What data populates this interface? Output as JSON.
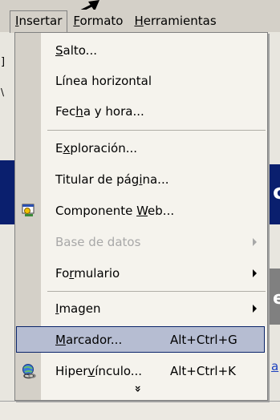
{
  "menubar": {
    "items": [
      {
        "pre": "",
        "u": "I",
        "post": "nsertar"
      },
      {
        "pre": "",
        "u": "F",
        "post": "ormato"
      },
      {
        "pre": "",
        "u": "H",
        "post": "erramientas"
      }
    ]
  },
  "menu": {
    "items": [
      {
        "pre": "",
        "u": "S",
        "post": "alto...",
        "shortcut": "",
        "enabled": true
      },
      {
        "pre": "Línea horizontal",
        "u": "",
        "post": "",
        "shortcut": "",
        "enabled": true
      },
      {
        "pre": "Fec",
        "u": "h",
        "post": "a y hora...",
        "shortcut": "",
        "enabled": true
      },
      {
        "pre": "E",
        "u": "x",
        "post": "ploración...",
        "shortcut": "",
        "enabled": true
      },
      {
        "pre": "Titular de pág",
        "u": "i",
        "post": "na...",
        "shortcut": "",
        "enabled": true
      },
      {
        "pre": "Componente ",
        "u": "W",
        "post": "eb...",
        "shortcut": "",
        "enabled": true,
        "icon": "web-component-icon"
      },
      {
        "pre": "Base de datos",
        "u": "",
        "post": "",
        "shortcut": "",
        "enabled": false,
        "submenu": true
      },
      {
        "pre": "Fo",
        "u": "r",
        "post": "mulario",
        "shortcut": "",
        "enabled": true,
        "submenu": true
      },
      {
        "pre": "",
        "u": "I",
        "post": "magen",
        "shortcut": "",
        "enabled": true,
        "submenu": true
      },
      {
        "pre": "",
        "u": "M",
        "post": "arcador...",
        "shortcut": "Alt+Ctrl+G",
        "enabled": true,
        "selected": true
      },
      {
        "pre": "Hiper",
        "u": "v",
        "post": "ínculo...",
        "shortcut": "Alt+Ctrl+K",
        "enabled": true,
        "icon": "hyperlink-icon"
      }
    ],
    "expand_glyph": "»"
  },
  "background": {
    "fragment_1": "]",
    "fragment_2": "\\",
    "fragment_3": "c",
    "fragment_4": "e",
    "fragment_5": "a"
  },
  "colors": {
    "highlight": "#b6bdd2",
    "highlight_border": "#0a246a",
    "menu_bg": "#f5f3ed",
    "gutter": "#d4d0c8"
  }
}
